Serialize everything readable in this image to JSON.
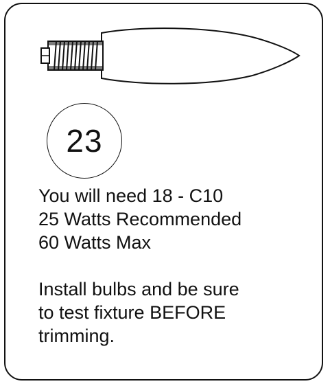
{
  "bulb": {
    "icon": "candelabra-bulb-icon"
  },
  "bulb_count_badge": "23",
  "requirements": {
    "line1": "You will need 18 - C10",
    "line2": "25 Watts Recommended",
    "line3": "60 Watts Max"
  },
  "instructions": {
    "line1": "Install bulbs and be sure",
    "line2": "to test fixture BEFORE",
    "line3": "trimming."
  }
}
